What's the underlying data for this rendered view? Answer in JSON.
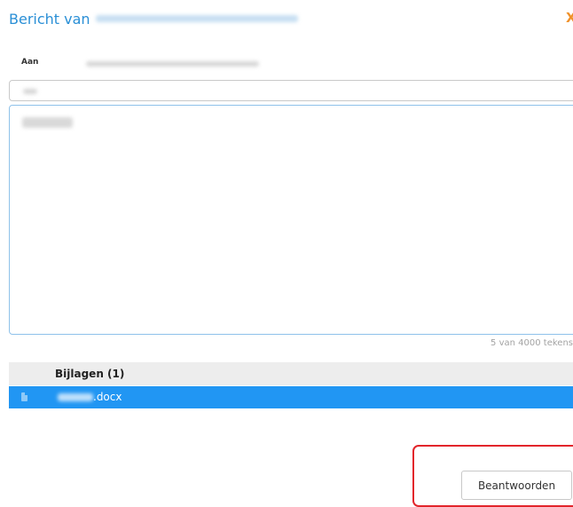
{
  "dialog": {
    "title_prefix": "Bericht van",
    "close_label": "X"
  },
  "recipient": {
    "label": "Aan"
  },
  "message": {
    "counter": "5 van 4000 tekens"
  },
  "attachments": {
    "header": "Bijlagen (1)",
    "items": [
      {
        "extension": ".docx",
        "icon": "document-icon"
      }
    ]
  },
  "actions": {
    "reply_label": "Beantwoorden"
  },
  "colors": {
    "title": "#2a8fd6",
    "close": "#f0922b",
    "selected_row": "#2196f3",
    "highlight": "#e2252b"
  }
}
